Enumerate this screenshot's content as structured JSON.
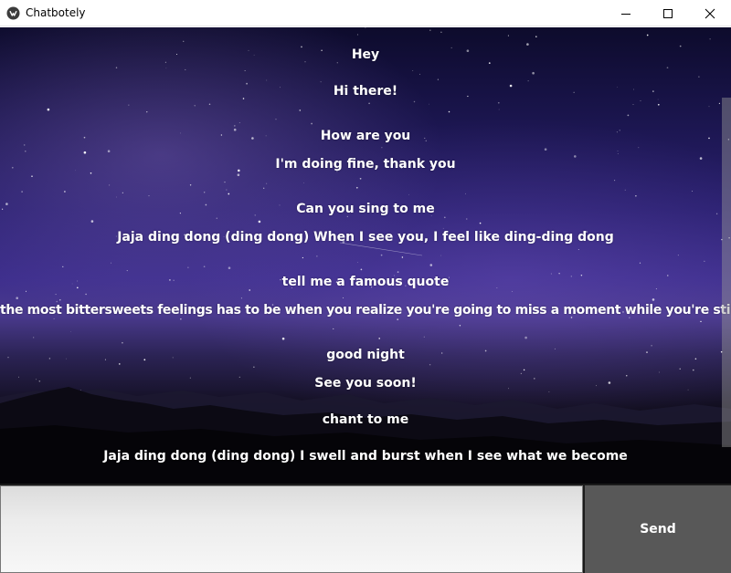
{
  "window": {
    "title": "Chatbotely",
    "app_icon": "chat-bubble-icon",
    "controls": [
      "minimize-icon",
      "maximize-icon",
      "close-icon"
    ]
  },
  "chat": {
    "messages": [
      {
        "text": "Hey"
      },
      {
        "text": "Hi there!"
      },
      {
        "text": "How are you"
      },
      {
        "text": "I'm doing fine, thank you"
      },
      {
        "text": "Can you sing to me"
      },
      {
        "text": "Jaja ding dong (ding dong) When I see you, I feel like ding-ding dong"
      },
      {
        "text": "tell me a famous quote"
      },
      {
        "text": "the most bittersweets feelings has to be when you realize you're going to miss a moment while you're still living it. By A"
      },
      {
        "text": "good night"
      },
      {
        "text": "See you soon!"
      },
      {
        "text": "chant to me"
      },
      {
        "text": "Jaja ding dong (ding dong) I swell and burst when I see what we become"
      }
    ]
  },
  "input": {
    "value": "",
    "placeholder": ""
  },
  "send_label": "Send",
  "colors": {
    "text": "#ffffff",
    "send_button_bg": "#585858",
    "sky_top": "#0d0b2c",
    "sky_horizon": "#4a3a8e"
  }
}
